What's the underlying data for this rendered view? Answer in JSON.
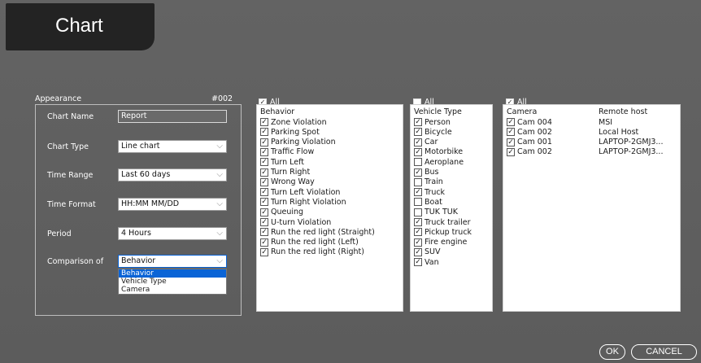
{
  "title": "Chart",
  "appearance": {
    "label": "Appearance",
    "code": "#002",
    "fields": [
      {
        "label": "Chart Name",
        "value": "Report"
      },
      {
        "label": "Chart Type",
        "value": "Line chart"
      },
      {
        "label": "Time Range",
        "value": "Last 60 days"
      },
      {
        "label": "Time Format",
        "value": "HH:MM MM/DD"
      },
      {
        "label": "Period",
        "value": "4 Hours"
      },
      {
        "label": "Comparison of",
        "value": "Behavior"
      }
    ],
    "comparison_options": [
      "Behavior",
      "Vehicle Type",
      "Camera"
    ]
  },
  "behavior": {
    "all_label": "All",
    "all_checked": true,
    "header": "Behavior",
    "items": [
      {
        "label": "Zone Violation",
        "checked": true
      },
      {
        "label": "Parking Spot",
        "checked": true
      },
      {
        "label": "Parking Violation",
        "checked": true
      },
      {
        "label": "Traffic Flow",
        "checked": true
      },
      {
        "label": "Turn Left",
        "checked": true
      },
      {
        "label": "Turn Right",
        "checked": true
      },
      {
        "label": "Wrong Way",
        "checked": true
      },
      {
        "label": "Turn Left Violation",
        "checked": true
      },
      {
        "label": "Turn Right Violation",
        "checked": true
      },
      {
        "label": "Queuing",
        "checked": true
      },
      {
        "label": "U-turn Violation",
        "checked": true
      },
      {
        "label": "Run the red light (Straight)",
        "checked": true
      },
      {
        "label": "Run the red light (Left)",
        "checked": true
      },
      {
        "label": "Run the red light (Right)",
        "checked": true
      }
    ]
  },
  "vehicle": {
    "all_label": "All",
    "all_checked": false,
    "header": "Vehicle Type",
    "items": [
      {
        "label": "Person",
        "checked": true
      },
      {
        "label": "Bicycle",
        "checked": true
      },
      {
        "label": "Car",
        "checked": true
      },
      {
        "label": "Motorbike",
        "checked": true
      },
      {
        "label": "Aeroplane",
        "checked": false
      },
      {
        "label": "Bus",
        "checked": true
      },
      {
        "label": "Train",
        "checked": false
      },
      {
        "label": "Truck",
        "checked": true
      },
      {
        "label": "Boat",
        "checked": false
      },
      {
        "label": "TUK TUK",
        "checked": false
      },
      {
        "label": "Truck trailer",
        "checked": true
      },
      {
        "label": "Pickup truck",
        "checked": true
      },
      {
        "label": "Fire engine",
        "checked": true
      },
      {
        "label": "SUV",
        "checked": true
      },
      {
        "label": "Van",
        "checked": true
      }
    ]
  },
  "camera": {
    "all_label": "All",
    "all_checked": true,
    "header_camera": "Camera",
    "header_host": "Remote host",
    "items": [
      {
        "label": "Cam 004",
        "host": "MSI",
        "checked": true
      },
      {
        "label": "Cam 002",
        "host": "Local Host",
        "checked": true
      },
      {
        "label": "Cam 001",
        "host": "LAPTOP-2GMJ3...",
        "checked": true
      },
      {
        "label": "Cam 002",
        "host": "LAPTOP-2GMJ3...",
        "checked": true
      }
    ]
  },
  "buttons": {
    "ok": "OK",
    "cancel": "CANCEL"
  },
  "check_glyph": "✓"
}
